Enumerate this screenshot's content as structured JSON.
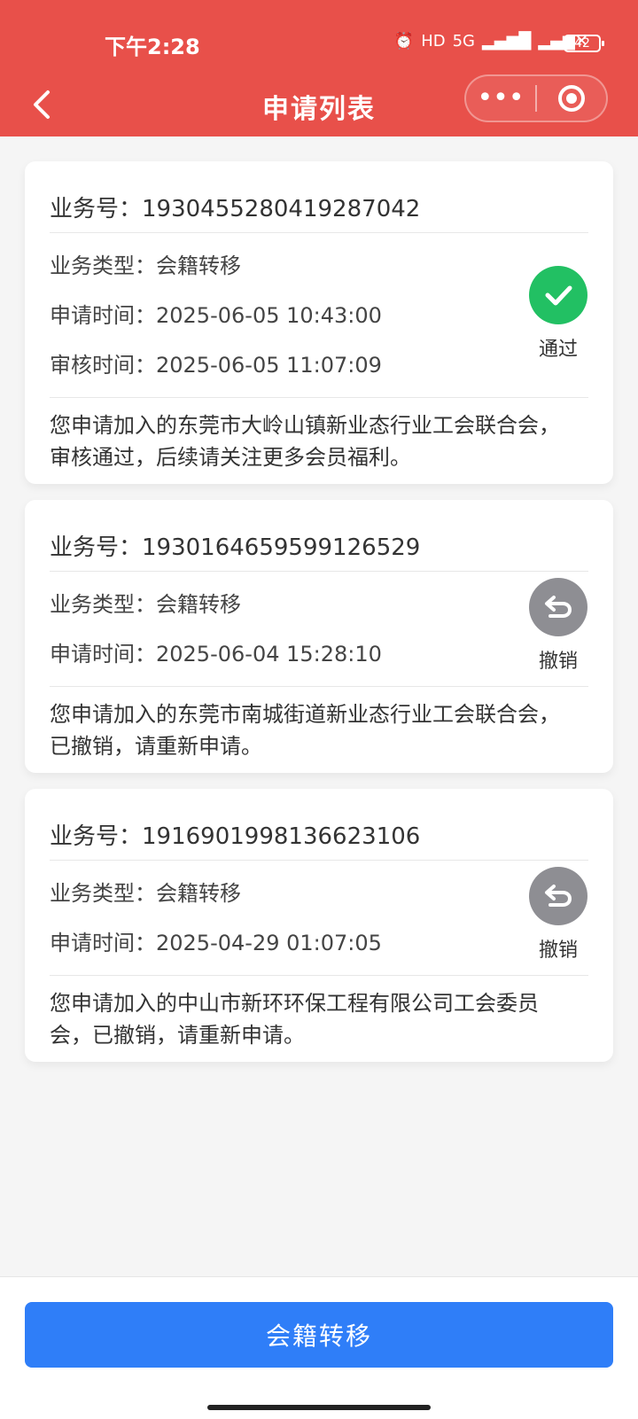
{
  "status_bar": {
    "time": "下午2:28",
    "battery": "42",
    "net": "5G"
  },
  "header": {
    "title": "申请列表",
    "more_label": "•••"
  },
  "labels": {
    "business_no": "业务号：",
    "business_type": "业务类型：",
    "apply_time": "申请时间：",
    "review_time": "审核时间："
  },
  "cards": [
    {
      "id": "1930455280419287042",
      "type": "会籍转移",
      "apply_time": "2025-06-05 10:43:00",
      "review_time": "2025-06-05 11:07:09",
      "status": "通过",
      "message": "您申请加入的东莞市大岭山镇新业态行业工会联合会，审核通过，后续请关注更多会员福利。",
      "status_color": "#22c063"
    },
    {
      "id": "1930164659599126529",
      "type": "会籍转移",
      "apply_time": "2025-06-04 15:28:10",
      "status": "撤销",
      "message": "您申请加入的东莞市南城街道新业态行业工会联合会，已撤销，请重新申请。",
      "status_color": "#8e8e93"
    },
    {
      "id": "1916901998136623106",
      "type": "会籍转移",
      "apply_time": "2025-04-29 01:07:05",
      "status": "撤销",
      "message": "您申请加入的中山市新环环保工程有限公司工会委员会，已撤销，请重新申请。",
      "status_color": "#8e8e93"
    }
  ],
  "footer": {
    "button_label": "会籍转移"
  }
}
